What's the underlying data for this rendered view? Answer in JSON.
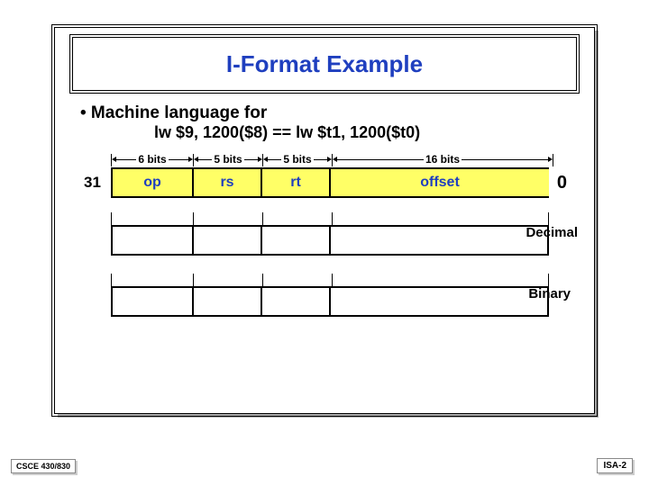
{
  "title": "I-Format Example",
  "bullet": "•  Machine language for",
  "code": "lw $9, 1200($8) == lw $t1, 1200($t0)",
  "bits": {
    "b6": "6 bits",
    "b5a": "5 bits",
    "b5b": "5 bits",
    "b16": "16 bits"
  },
  "fields": {
    "op": "op",
    "rs": "rs",
    "rt": "rt",
    "offset": "offset"
  },
  "msb": "31",
  "lsb": "0",
  "rows": {
    "decimal": "Decimal",
    "binary": "Binary"
  },
  "footer": {
    "left": "CSCE 430/830",
    "right": "ISA-2"
  },
  "widths": {
    "w6": 90,
    "w5a": 76,
    "w5b": 76,
    "w16": 244
  }
}
